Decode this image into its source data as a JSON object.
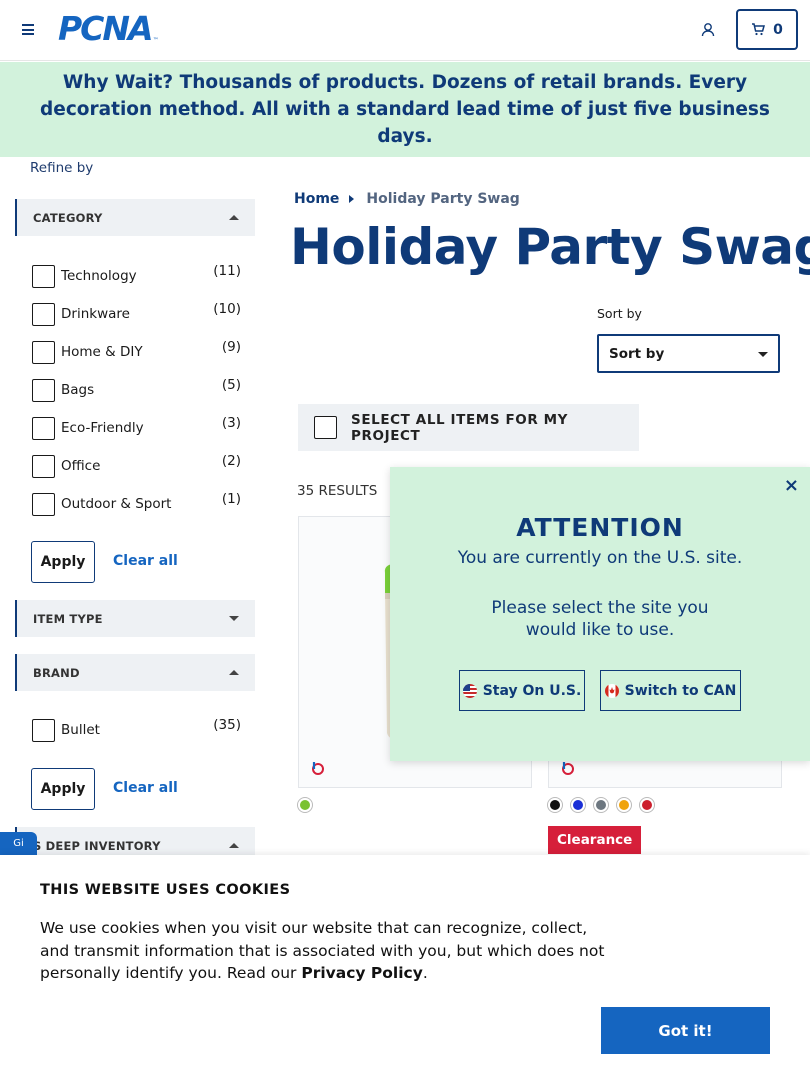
{
  "header": {
    "logo_text": "PCNA",
    "logo_tm": "™",
    "cart_count": "0"
  },
  "banner": {
    "lead": "Why Wait?",
    "text": " Thousands of products. Dozens of retail brands. Every decoration method. All with a standard lead time of just five business days."
  },
  "sidebar": {
    "refine_label": "Refine by",
    "category": {
      "title": "CATEGORY",
      "items": [
        {
          "label": "Technology",
          "count": "(11)"
        },
        {
          "label": "Drinkware",
          "count": "(10)"
        },
        {
          "label": "Home & DIY",
          "count": "(9)"
        },
        {
          "label": "Bags",
          "count": "(5)"
        },
        {
          "label": "Eco-Friendly",
          "count": "(3)"
        },
        {
          "label": "Office",
          "count": "(2)"
        },
        {
          "label": "Outdoor & Sport",
          "count": "(1)"
        }
      ],
      "apply_label": "Apply",
      "clear_label": "Clear all"
    },
    "item_type": {
      "title": "ITEM TYPE"
    },
    "brand": {
      "title": "BRAND",
      "items": [
        {
          "label": "Bullet",
          "count": "(35)"
        }
      ],
      "apply_label": "Apply",
      "clear_label": "Clear all"
    },
    "deep_inventory": {
      "title": "S DEEP INVENTORY"
    }
  },
  "main": {
    "breadcrumb": {
      "home": "Home",
      "current": "Holiday Party Swag"
    },
    "title": "Holiday Party Swag",
    "sort": {
      "label": "Sort by",
      "value": "Sort by"
    },
    "select_all_label": "SELECT ALL ITEMS FOR MY PROJECT",
    "results_count": "35 RESULTS",
    "products": [
      {
        "swatches": [
          "#7ac231"
        ]
      },
      {
        "swatches": [
          "#111111",
          "#1a2fd6",
          "#6d7780",
          "#f0a30a",
          "#cc1f2d"
        ],
        "badge": "Clearance"
      }
    ]
  },
  "attention": {
    "title": "ATTENTION",
    "line1": "You are currently on the U.S. site.",
    "line2": "Please select the site you",
    "line3": "would like to use.",
    "us_button": "Stay On U.S.",
    "ca_button": "Switch to CAN",
    "close": "×"
  },
  "feedback_tab": "Gi",
  "cookie": {
    "title": "THIS WEBSITE USES COOKIES",
    "text": "We use cookies when you visit our website that can recognize, collect, and transmit information that is associated with you, but which does not personally identify you. Read our ",
    "link": "Privacy Policy",
    "end": ".",
    "button": "Got it!"
  },
  "colors": {
    "brand_blue": "#0f3a78",
    "link_blue": "#1565c0",
    "banner_green": "#d2f2dc",
    "clearance_red": "#d61f3a"
  }
}
